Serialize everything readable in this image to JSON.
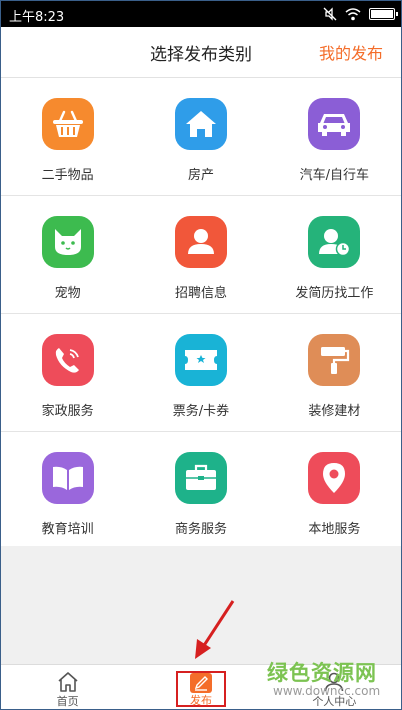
{
  "status_bar": {
    "time": "上午8:23",
    "battery_level": 0.9
  },
  "header": {
    "title": "选择发布类别",
    "my_publish": "我的发布"
  },
  "categories": [
    {
      "label": "二手物品",
      "icon": "basket-icon",
      "color": "#f68a2e"
    },
    {
      "label": "房产",
      "icon": "house-icon",
      "color": "#2f9de9"
    },
    {
      "label": "汽车/自行车",
      "icon": "car-icon",
      "color": "#8b5ed6"
    },
    {
      "label": "宠物",
      "icon": "cat-icon",
      "color": "#3dbb4f"
    },
    {
      "label": "招聘信息",
      "icon": "person-icon",
      "color": "#f1573a"
    },
    {
      "label": "发简历找工作",
      "icon": "person-clock-icon",
      "color": "#25b37a"
    },
    {
      "label": "家政服务",
      "icon": "phone-icon",
      "color": "#ee4c5a"
    },
    {
      "label": "票务/卡券",
      "icon": "ticket-icon",
      "color": "#19b3d6"
    },
    {
      "label": "装修建材",
      "icon": "paint-roller-icon",
      "color": "#df8d57"
    },
    {
      "label": "教育培训",
      "icon": "book-icon",
      "color": "#9a67dc"
    },
    {
      "label": "商务服务",
      "icon": "briefcase-icon",
      "color": "#1eb28a"
    },
    {
      "label": "本地服务",
      "icon": "location-pin-icon",
      "color": "#ee4c5a"
    }
  ],
  "tabbar": {
    "home": "首页",
    "publish": "发布",
    "profile": "个人中心",
    "accent": "#f46d2a"
  },
  "watermark": {
    "brand": "绿色资源网",
    "url": "www.downcc.com"
  }
}
